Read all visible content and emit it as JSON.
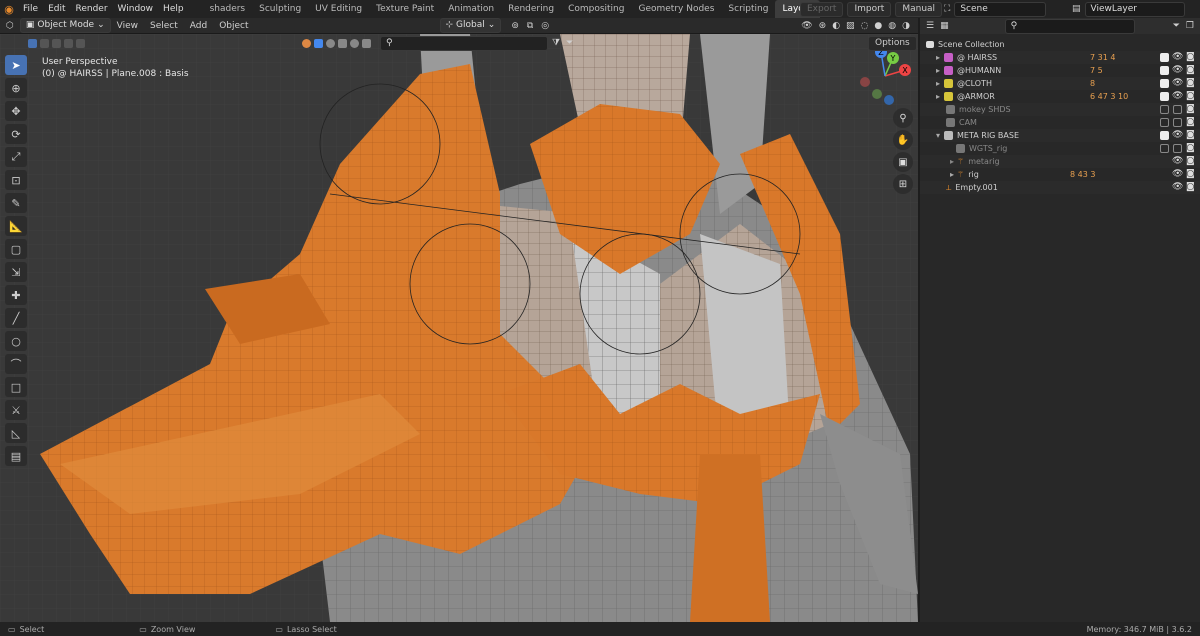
{
  "menu": {
    "file": "File",
    "edit": "Edit",
    "render": "Render",
    "window": "Window",
    "help": "Help"
  },
  "workspace_tabs": [
    "shaders",
    "Sculpting",
    "UV Editing",
    "Texture Paint",
    "Animation",
    "Rendering",
    "Compositing",
    "Geometry Nodes",
    "Scripting",
    "Layout"
  ],
  "active_tab": "Layout",
  "topbar": {
    "export": "Export",
    "import": "Import",
    "manual": "Manual",
    "scene": "Scene",
    "view_layer": "ViewLayer"
  },
  "viewport_header": {
    "mode": "Object Mode",
    "view": "View",
    "select": "Select",
    "add": "Add",
    "object": "Object",
    "orientation": "Global",
    "options": "Options"
  },
  "viewport": {
    "perspective": "User Perspective",
    "active_object": "(0) @ HAIRSS | Plane.008 : Basis"
  },
  "gizmo": {
    "x": "X",
    "y": "Y",
    "z": "Z"
  },
  "outliner": {
    "title": "Scene Collection",
    "rows": [
      {
        "label": "@ HAIRSS",
        "color": "#c65fc6",
        "badges": "7 31 4",
        "dim": false,
        "checked": true
      },
      {
        "label": "@HUMANN",
        "color": "#c65fc6",
        "badges": "7 5",
        "dim": false,
        "checked": true
      },
      {
        "label": "@CLOTH",
        "color": "#d6c53a",
        "badges": "8",
        "dim": false,
        "checked": true
      },
      {
        "label": "@ARMOR",
        "color": "#d6c53a",
        "badges": "6 47 3 10",
        "dim": false,
        "checked": true
      },
      {
        "label": "mokey SHDS",
        "color": "#777777",
        "badges": "",
        "dim": true,
        "checked": false
      },
      {
        "label": "CAM",
        "color": "#777777",
        "badges": "",
        "dim": true,
        "checked": false
      },
      {
        "label": "META RIG BASE",
        "color": "#bbbbbb",
        "badges": "",
        "dim": false,
        "checked": true
      },
      {
        "label": "WGTS_rig",
        "color": "#777777",
        "badges": "",
        "dim": true,
        "checked": false
      },
      {
        "label": "metarig",
        "color": "#e08a2c",
        "badges": "",
        "dim": true,
        "checked": false
      },
      {
        "label": "rig",
        "color": "#e08a2c",
        "badges": "8 43 3",
        "dim": false,
        "checked": false
      },
      {
        "label": "Empty.001",
        "color": "#e08a2c",
        "badges": "",
        "dim": false,
        "checked": false
      }
    ]
  },
  "status": {
    "select": "Select",
    "zoom": "Zoom View",
    "lasso": "Lasso Select",
    "memory": "Memory: 346.7 MiB | 3.6.2"
  }
}
